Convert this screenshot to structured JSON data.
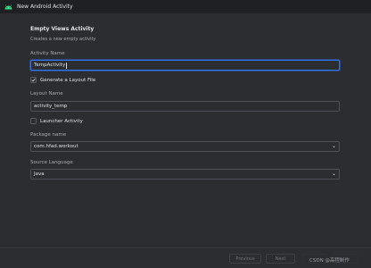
{
  "window": {
    "title": "New Android Activity"
  },
  "form": {
    "heading": "Empty Views Activity",
    "subheading": "Creates a new empty activity",
    "activity_name_label": "Activity Name",
    "activity_name_value": "TempActivity",
    "generate_layout_label": "Generate a Layout File",
    "generate_layout_checked": true,
    "layout_name_label": "Layout Name",
    "layout_name_value": "activity_temp",
    "launcher_label": "Launcher Activity",
    "launcher_checked": false,
    "package_label": "Package name",
    "package_value": "com.hfad.workout",
    "language_label": "Source Language",
    "language_value": "Java"
  },
  "footer": {
    "previous_label": "Previous",
    "next_label": "Next",
    "watermark": "CSDN @高程制作"
  },
  "colors": {
    "accent": "#3574f0",
    "background": "#2b2d30",
    "titlebar": "#1f2023",
    "android_green": "#3ddc84"
  },
  "icons": {
    "app": "android-icon",
    "checkbox": "checkmark-icon",
    "dropdown": "chevron-down-icon"
  }
}
